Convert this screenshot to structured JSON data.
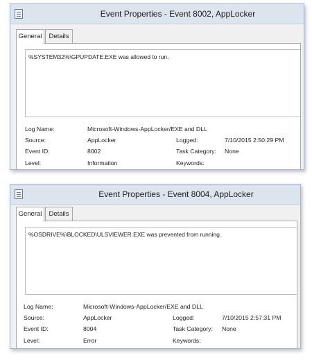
{
  "windows": [
    {
      "title": "Event Properties - Event 8002, AppLocker",
      "tabs": [
        "General",
        "Details"
      ],
      "message": "%SYSTEM32%\\GPUPDATE.EXE was allowed to run.",
      "labels": {
        "log_name": "Log Name:",
        "source": "Source:",
        "event_id": "Event ID:",
        "level": "Level:",
        "logged": "Logged:",
        "task_category": "Task Category:",
        "keywords": "Keywords:"
      },
      "values": {
        "log_name": "Microsoft-Windows-AppLocker/EXE and DLL",
        "source": "AppLocker",
        "event_id": "8002",
        "level": "Information",
        "logged": "7/10/2015 2:50:29 PM",
        "task_category": "None",
        "keywords": ""
      }
    },
    {
      "title": "Event Properties - Event 8004, AppLocker",
      "tabs": [
        "General",
        "Details"
      ],
      "message": "%OSDRIVE%\\BLOCKED\\ULSVIEWER.EXE was prevented from running.",
      "labels": {
        "log_name": "Log Name:",
        "source": "Source:",
        "event_id": "Event ID:",
        "level": "Level:",
        "logged": "Logged:",
        "task_category": "Task Category:",
        "keywords": "Keywords:"
      },
      "values": {
        "log_name": "Microsoft-Windows-AppLocker/EXE and DLL",
        "source": "AppLocker",
        "event_id": "8004",
        "level": "Error",
        "logged": "7/10/2015 2:57:31 PM",
        "task_category": "None",
        "keywords": ""
      }
    }
  ],
  "icons": {
    "window_icon": "event-viewer-icon"
  }
}
